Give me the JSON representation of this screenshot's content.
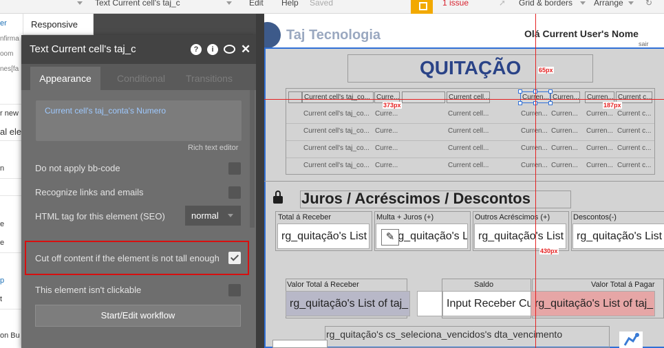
{
  "topbar": {
    "element_select": "Text Current cell's taj_c",
    "menu_edit": "Edit",
    "menu_help": "Help",
    "saved": "Saved",
    "issue": "1 issue",
    "grid_borders": "Grid & borders",
    "arrange": "Arrange"
  },
  "left_sidebar": {
    "items": [
      "er",
      "nfirma",
      "oom",
      "nes[fa",
      "r new",
      "al ele",
      "n",
      "e",
      "e",
      "p",
      "t",
      "on Bu"
    ]
  },
  "responsive_tab": "Responsive",
  "panel": {
    "title": "Text Current cell's taj_c",
    "tabs": [
      "Appearance",
      "Conditional",
      "Transitions"
    ],
    "rich_text_value": "Current cell's taj_conta's Numero",
    "rich_text_link": "Rich text editor",
    "options": [
      {
        "label": "Do not apply bb-code",
        "checked": false
      },
      {
        "label": "Recognize links and emails",
        "checked": false
      },
      {
        "label": "Cut off content if the element is not tall enough",
        "checked": true
      },
      {
        "label": "This element isn't clickable",
        "checked": false
      }
    ],
    "seo_label": "HTML tag for this element (SEO)",
    "seo_value": "normal",
    "workflow_button": "Start/Edit workflow"
  },
  "canvas": {
    "brand": "Taj Tecnologia",
    "greeting": "Olá Current User's Nome",
    "logout": "sair",
    "title": "QUITAÇÃO",
    "grid_header": [
      "Current cell's taj_co...",
      "Curre...",
      "Current cell...",
      "Curren...",
      "Curren...",
      "Curren...",
      "Current c..."
    ],
    "grid_rows": [
      [
        "Current cell's taj_co...",
        "Curre...",
        "Current cell...",
        "Curren...",
        "Curren...",
        "Curren...",
        "Current c..."
      ],
      [
        "Current cell's taj_co...",
        "Curre...",
        "Current cell...",
        "Curren...",
        "Curren...",
        "Curren...",
        "Current c..."
      ],
      [
        "Current cell's taj_co...",
        "Curre...",
        "Current cell...",
        "Curren...",
        "Curren...",
        "Curren...",
        "Current c..."
      ],
      [
        "Current cell's taj_co...",
        "Curre...",
        "Current cell...",
        "Curren...",
        "Curren...",
        "Curren...",
        "Current c..."
      ]
    ],
    "section_title": "Juros / Acréscimos / Descontos",
    "fields1": [
      {
        "label": "Total á Receber",
        "value": "rg_quitação's List of taj_"
      },
      {
        "label": "Multa + Juros (+)",
        "value": "rg_quitação's List of taj_"
      },
      {
        "label": "Outros Acréscimos (+)",
        "value": "rg_quitação's List of taj_"
      },
      {
        "label": "Descontos(-)",
        "value": "rg_quitação's List of taj_"
      }
    ],
    "fields2": [
      {
        "label": "Valor Total á Receber",
        "value": "rg_quitação's List of taj_"
      },
      {
        "label": "Saldo",
        "value": "Input Receber Current"
      },
      {
        "label": "Valor Total á Pagar",
        "value": "rg_quitação's List of taj_"
      }
    ],
    "bottom_text": "rg_quitação's cs_seleciona_vencidos's dta_vencimento",
    "measurements": [
      "65px",
      "373px",
      "187px",
      "430px"
    ]
  },
  "colors": {
    "accent_title": "#2a4387",
    "guide": "#e52020",
    "highlight": "#d80f0f",
    "pay_field": "#e6a6a6",
    "receive_field": "#b8b8c8"
  }
}
